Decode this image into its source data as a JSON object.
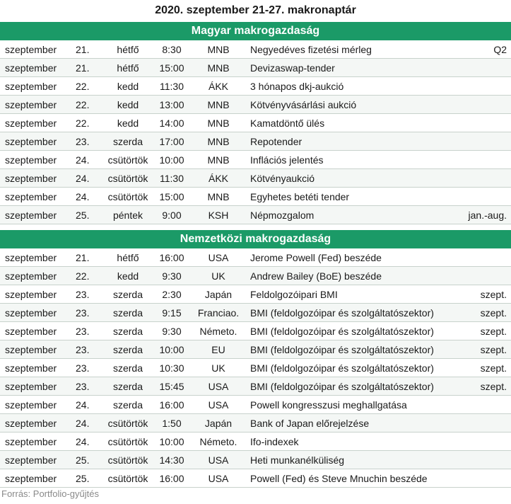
{
  "title": "2020. szeptember 21-27. makronaptár",
  "sections": [
    {
      "heading": "Magyar makrogazdaság",
      "rows": [
        {
          "month": "szeptember",
          "day": "21.",
          "weekday": "hétfő",
          "time": "8:30",
          "source": "MNB",
          "event": "Negyedéves fizetési mérleg",
          "period": "Q2"
        },
        {
          "month": "szeptember",
          "day": "21.",
          "weekday": "hétfő",
          "time": "15:00",
          "source": "MNB",
          "event": "Devizaswap-tender",
          "period": ""
        },
        {
          "month": "szeptember",
          "day": "22.",
          "weekday": "kedd",
          "time": "11:30",
          "source": "ÁKK",
          "event": "3 hónapos dkj-aukció",
          "period": ""
        },
        {
          "month": "szeptember",
          "day": "22.",
          "weekday": "kedd",
          "time": "13:00",
          "source": "MNB",
          "event": "Kötvényvásárlási aukció",
          "period": ""
        },
        {
          "month": "szeptember",
          "day": "22.",
          "weekday": "kedd",
          "time": "14:00",
          "source": "MNB",
          "event": "Kamatdöntő ülés",
          "period": ""
        },
        {
          "month": "szeptember",
          "day": "23.",
          "weekday": "szerda",
          "time": "17:00",
          "source": "MNB",
          "event": "Repotender",
          "period": ""
        },
        {
          "month": "szeptember",
          "day": "24.",
          "weekday": "csütörtök",
          "time": "10:00",
          "source": "MNB",
          "event": "Inflációs jelentés",
          "period": ""
        },
        {
          "month": "szeptember",
          "day": "24.",
          "weekday": "csütörtök",
          "time": "11:30",
          "source": "ÁKK",
          "event": "Kötvényaukció",
          "period": ""
        },
        {
          "month": "szeptember",
          "day": "24.",
          "weekday": "csütörtök",
          "time": "15:00",
          "source": "MNB",
          "event": "Egyhetes betéti tender",
          "period": ""
        },
        {
          "month": "szeptember",
          "day": "25.",
          "weekday": "péntek",
          "time": "9:00",
          "source": "KSH",
          "event": "Népmozgalom",
          "period": "jan.-aug."
        }
      ]
    },
    {
      "heading": "Nemzetközi makrogazdaság",
      "rows": [
        {
          "month": "szeptember",
          "day": "21.",
          "weekday": "hétfő",
          "time": "16:00",
          "source": "USA",
          "event": "Jerome Powell (Fed) beszéde",
          "period": ""
        },
        {
          "month": "szeptember",
          "day": "22.",
          "weekday": "kedd",
          "time": "9:30",
          "source": "UK",
          "event": "Andrew Bailey (BoE) beszéde",
          "period": ""
        },
        {
          "month": "szeptember",
          "day": "23.",
          "weekday": "szerda",
          "time": "2:30",
          "source": "Japán",
          "event": "Feldolgozóipari BMI",
          "period": "szept."
        },
        {
          "month": "szeptember",
          "day": "23.",
          "weekday": "szerda",
          "time": "9:15",
          "source": "Franciao.",
          "event": "BMI (feldolgozóipar és szolgáltatószektor)",
          "period": "szept."
        },
        {
          "month": "szeptember",
          "day": "23.",
          "weekday": "szerda",
          "time": "9:30",
          "source": "Németo.",
          "event": "BMI (feldolgozóipar és szolgáltatószektor)",
          "period": "szept."
        },
        {
          "month": "szeptember",
          "day": "23.",
          "weekday": "szerda",
          "time": "10:00",
          "source": "EU",
          "event": "BMI (feldolgozóipar és szolgáltatószektor)",
          "period": "szept."
        },
        {
          "month": "szeptember",
          "day": "23.",
          "weekday": "szerda",
          "time": "10:30",
          "source": "UK",
          "event": "BMI (feldolgozóipar és szolgáltatószektor)",
          "period": "szept."
        },
        {
          "month": "szeptember",
          "day": "23.",
          "weekday": "szerda",
          "time": "15:45",
          "source": "USA",
          "event": "BMI (feldolgozóipar és szolgáltatószektor)",
          "period": "szept."
        },
        {
          "month": "szeptember",
          "day": "24.",
          "weekday": "szerda",
          "time": "16:00",
          "source": "USA",
          "event": "Powell kongresszusi meghallgatása",
          "period": ""
        },
        {
          "month": "szeptember",
          "day": "24.",
          "weekday": "csütörtök",
          "time": "1:50",
          "source": "Japán",
          "event": "Bank of Japan előrejelzése",
          "period": ""
        },
        {
          "month": "szeptember",
          "day": "24.",
          "weekday": "csütörtök",
          "time": "10:00",
          "source": "Németo.",
          "event": "Ifo-indexek",
          "period": ""
        },
        {
          "month": "szeptember",
          "day": "25.",
          "weekday": "csütörtök",
          "time": "14:30",
          "source": "USA",
          "event": "Heti munkanélküliség",
          "period": ""
        },
        {
          "month": "szeptember",
          "day": "25.",
          "weekday": "csütörtök",
          "time": "16:00",
          "source": "USA",
          "event": "Powell (Fed) és Steve Mnuchin beszéde",
          "period": ""
        }
      ]
    }
  ],
  "footer": "Forrás: Portfolio-gyűjtés",
  "colors": {
    "section_bg": "#1b9a67",
    "section_text": "#ffffff"
  }
}
